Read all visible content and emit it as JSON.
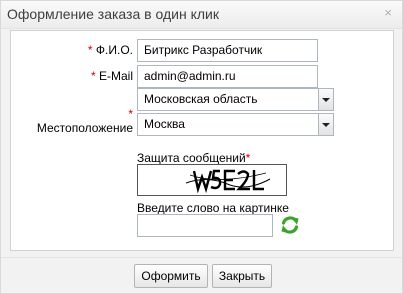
{
  "window": {
    "title": "Оформление заказа в один клик",
    "close_glyph": "×"
  },
  "form": {
    "required_mark": "*",
    "fio_label": "Ф.И.О.",
    "fio_value": "Битрикс Разработчик",
    "email_label": "E-Mail",
    "email_value": "admin@admin.ru",
    "location_label": "Местоположение",
    "region_value": "Московская область",
    "city_value": "Москва"
  },
  "captcha": {
    "label": "Защита сообщений",
    "required_mark": "*",
    "image_text": "W5E2L",
    "prompt": "Введите слово на картинке",
    "answer_value": "",
    "refresh_icon": "refresh-icon",
    "refresh_color": "#3aa52a"
  },
  "buttons": {
    "submit_label": "Оформить",
    "close_label": "Закрыть"
  },
  "colors": {
    "required": "#d00000",
    "border": "#aeb6bf"
  }
}
